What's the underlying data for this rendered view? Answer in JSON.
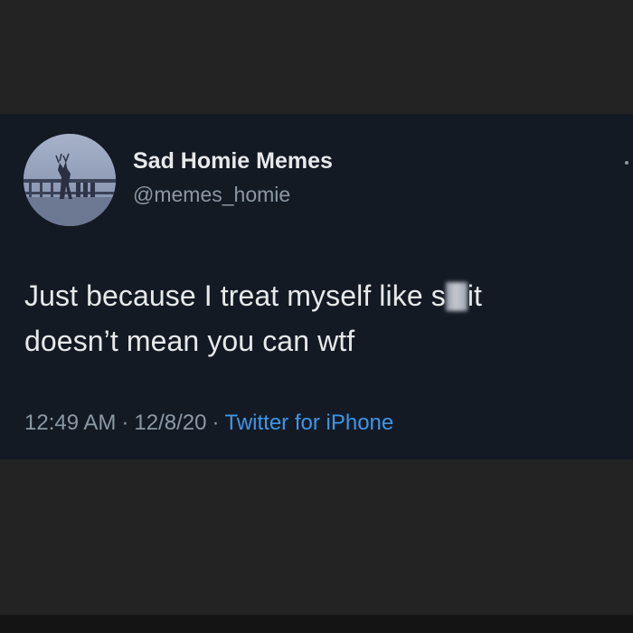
{
  "tweet": {
    "display_name": "Sad Homie Memes",
    "handle": "@memes_homie",
    "avatar_icon": "avatar-deer-bridge-photo",
    "text_line1_before": "Just because I treat myself like s",
    "text_line1_after": "it",
    "text_line2": "doesn’t mean you can wtf",
    "time": "12:49 AM",
    "date": "12/8/20",
    "separator": "·",
    "source": "Twitter for iPhone",
    "colors": {
      "card_background": "#141a24",
      "page_background": "#232323",
      "primary_text": "#e7e9ea",
      "secondary_text": "#8b98a5",
      "link": "#3b97e8"
    }
  }
}
